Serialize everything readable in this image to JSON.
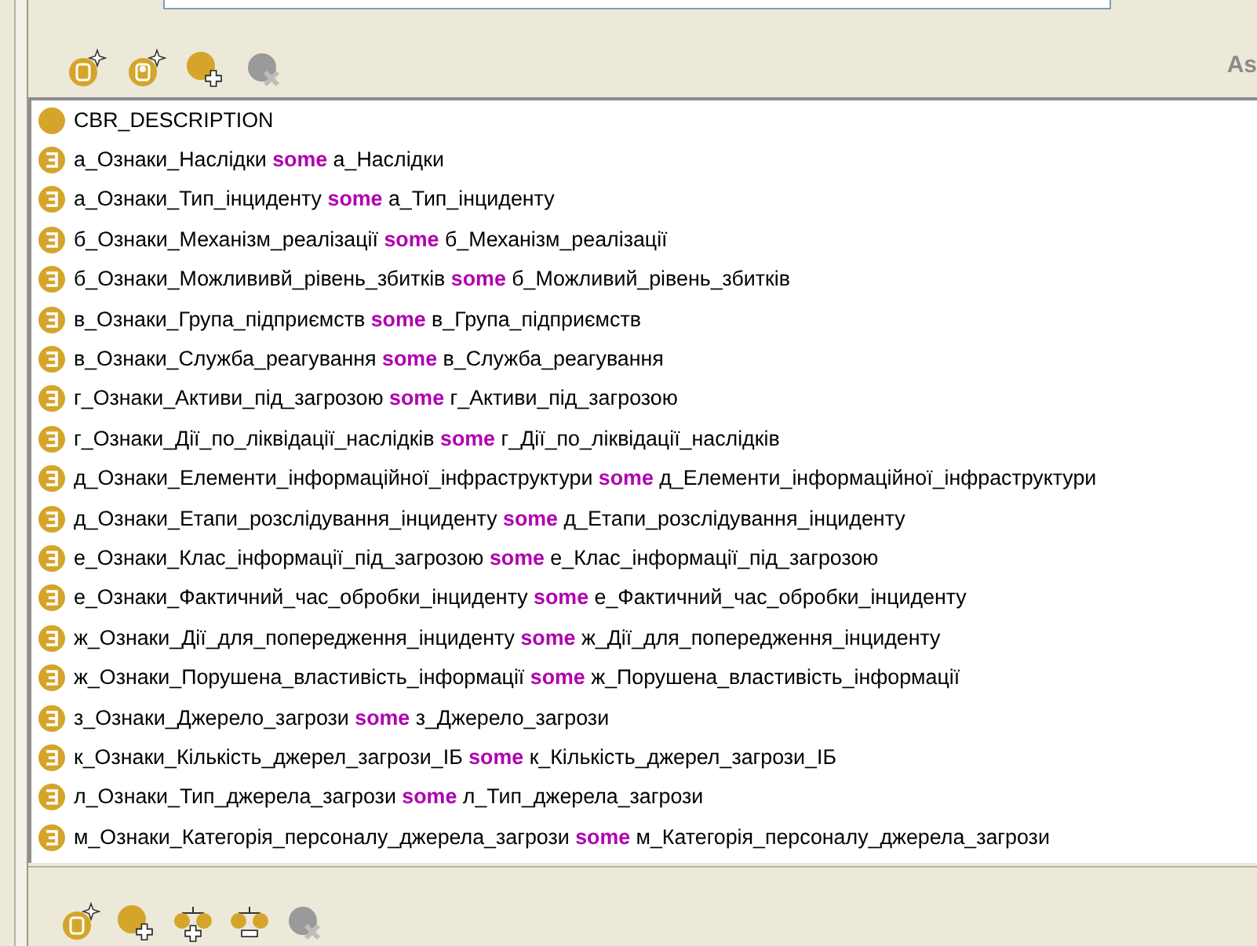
{
  "header": {
    "side_label": "As"
  },
  "top_toolbar": [
    {
      "kind": "add-letter-u",
      "disabled": false
    },
    {
      "kind": "add-letter-r",
      "disabled": false
    },
    {
      "kind": "add-class",
      "disabled": false
    },
    {
      "kind": "delete",
      "disabled": true
    }
  ],
  "rows": [
    {
      "kind": "class",
      "name": "CBR_DESCRIPTION"
    },
    {
      "kind": "restriction",
      "property": "а_Ознаки_Наслідки",
      "quantifier": "some",
      "filler": "а_Наслідки"
    },
    {
      "kind": "restriction",
      "property": "а_Ознаки_Тип_інциденту",
      "quantifier": "some",
      "filler": "а_Тип_інциденту"
    },
    {
      "kind": "restriction",
      "property": "б_Ознаки_Механізм_реалізації",
      "quantifier": "some",
      "filler": "б_Механізм_реалізації"
    },
    {
      "kind": "restriction",
      "property": "б_Ознаки_Можлививй_рівень_збитків",
      "quantifier": "some",
      "filler": "б_Можливий_рівень_збитків"
    },
    {
      "kind": "restriction",
      "property": "в_Ознаки_Група_підприємств",
      "quantifier": "some",
      "filler": "в_Група_підприємств"
    },
    {
      "kind": "restriction",
      "property": "в_Ознаки_Служба_реагування",
      "quantifier": "some",
      "filler": "в_Служба_реагування"
    },
    {
      "kind": "restriction",
      "property": "г_Ознаки_Активи_під_загрозою",
      "quantifier": "some",
      "filler": "г_Активи_під_загрозою"
    },
    {
      "kind": "restriction",
      "property": "г_Ознаки_Дії_по_ліквідації_наслідків",
      "quantifier": "some",
      "filler": "г_Дії_по_ліквідації_наслідків"
    },
    {
      "kind": "restriction",
      "property": "д_Ознаки_Елементи_інформаційної_інфраструктури",
      "quantifier": "some",
      "filler": "д_Елементи_інформаційної_інфраструктури"
    },
    {
      "kind": "restriction",
      "property": "д_Ознаки_Етапи_розслідування_інциденту",
      "quantifier": "some",
      "filler": "д_Етапи_розслідування_інциденту"
    },
    {
      "kind": "restriction",
      "property": "е_Ознаки_Клас_інформації_під_загрозою",
      "quantifier": "some",
      "filler": "е_Клас_інформації_під_загрозою"
    },
    {
      "kind": "restriction",
      "property": "е_Ознаки_Фактичний_час_обробки_інциденту",
      "quantifier": "some",
      "filler": "е_Фактичний_час_обробки_інциденту"
    },
    {
      "kind": "restriction",
      "property": "ж_Ознаки_Дії_для_попередження_інциденту",
      "quantifier": "some",
      "filler": "ж_Дії_для_попередження_інциденту"
    },
    {
      "kind": "restriction",
      "property": "ж_Ознаки_Порушена_властивість_інформації",
      "quantifier": "some",
      "filler": "ж_Порушена_властивість_інформації"
    },
    {
      "kind": "restriction",
      "property": "з_Ознаки_Джерело_загрози",
      "quantifier": "some",
      "filler": "з_Джерело_загрози"
    },
    {
      "kind": "restriction",
      "property": "к_Ознаки_Кількість_джерел_загрози_ІБ",
      "quantifier": "some",
      "filler": "к_Кількість_джерел_загрози_ІБ"
    },
    {
      "kind": "restriction",
      "property": "л_Ознаки_Тип_джерела_загрози",
      "quantifier": "some",
      "filler": "л_Тип_джерела_загрози"
    },
    {
      "kind": "restriction",
      "property": "м_Ознаки_Категорія_персоналу_джерела_загрози",
      "quantifier": "some",
      "filler": "м_Категорія_персоналу_джерела_загрози"
    }
  ],
  "bottom_toolbar": [
    {
      "kind": "add-letter-u",
      "disabled": false
    },
    {
      "kind": "add-class",
      "disabled": false
    },
    {
      "kind": "add-pair",
      "disabled": false
    },
    {
      "kind": "remove-pair",
      "disabled": false
    },
    {
      "kind": "delete",
      "disabled": true
    }
  ]
}
